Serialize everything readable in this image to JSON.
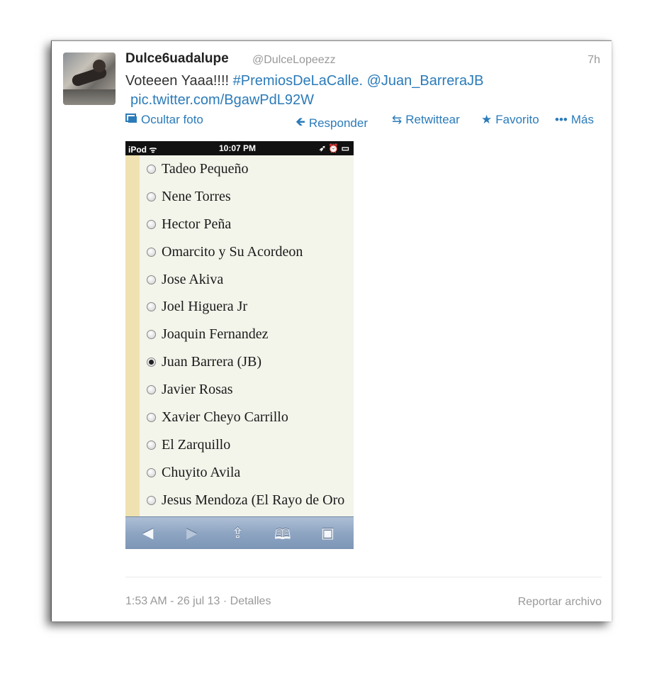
{
  "tweet": {
    "author_name": "Dulce6uadalupe",
    "author_handle": "@DulceLopeezz",
    "time_ago": "7h",
    "text_prefix": "Voteeen Yaaa!!!! ",
    "hashtag": "#PremiosDeLaCalle.",
    "mention": "@Juan_BarreraJB",
    "pic_link": "pic.twitter.com/BgawPdL92W"
  },
  "actions": {
    "hide_photo": "Ocultar foto",
    "reply": "Responder",
    "retweet": "Retwittear",
    "favorite": "Favorito",
    "more": "Más"
  },
  "photo": {
    "status_left": "iPod ᯤ",
    "status_time": "10:07 PM",
    "status_right": "➶ ⏰ ▭",
    "options": [
      {
        "label": "Tadeo Pequeño",
        "selected": false
      },
      {
        "label": "Nene Torres",
        "selected": false
      },
      {
        "label": "Hector Peña",
        "selected": false
      },
      {
        "label": "Omarcito y Su Acordeon",
        "selected": false
      },
      {
        "label": "Jose Akiva",
        "selected": false
      },
      {
        "label": "Joel Higuera Jr",
        "selected": false
      },
      {
        "label": "Joaquin Fernandez",
        "selected": false
      },
      {
        "label": "Juan Barrera (JB)",
        "selected": true
      },
      {
        "label": "Javier Rosas",
        "selected": false
      },
      {
        "label": "Xavier Cheyo Carrillo",
        "selected": false
      },
      {
        "label": "El Zarquillo",
        "selected": false
      },
      {
        "label": "Chuyito Avila",
        "selected": false
      },
      {
        "label": "Jesus Mendoza (El Rayo de Oro",
        "selected": false
      }
    ],
    "toolbar_icons": [
      "back-arrow-icon",
      "forward-arrow-icon",
      "share-icon",
      "bookmarks-icon",
      "tabs-icon"
    ]
  },
  "footer": {
    "timestamp": "1:53 AM - 26 jul 13",
    "separator": " · ",
    "details": "Detalles",
    "report": "Reportar archivo"
  },
  "colors": {
    "link": "#2b7bb9",
    "meta": "#999999",
    "toolbar": "#8ea5c2"
  }
}
